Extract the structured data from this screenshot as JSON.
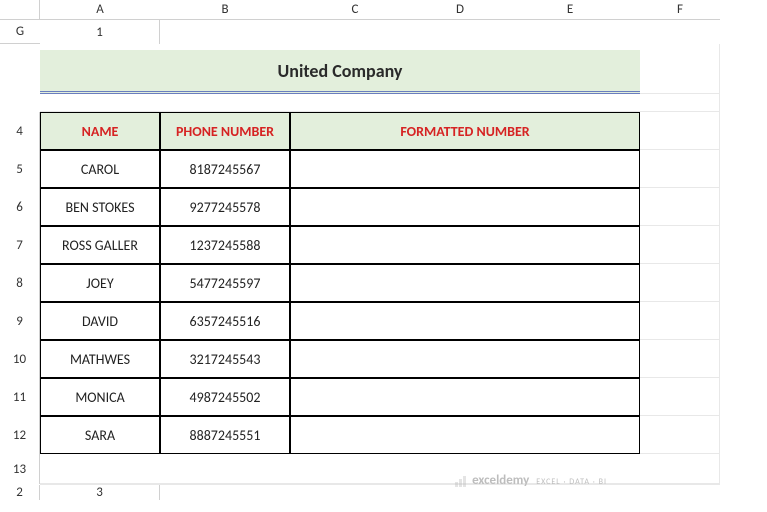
{
  "columns": [
    "A",
    "B",
    "C",
    "D",
    "E",
    "F",
    "G"
  ],
  "rows": [
    "1",
    "2",
    "3",
    "4",
    "5",
    "6",
    "7",
    "8",
    "9",
    "10",
    "11",
    "12",
    "13"
  ],
  "title": "United Company",
  "headers": {
    "name": "NAME",
    "phone": "PHONE NUMBER",
    "formatted": "FORMATTED NUMBER"
  },
  "data": [
    {
      "name": "CAROL",
      "phone": "8187245567",
      "formatted": ""
    },
    {
      "name": "BEN STOKES",
      "phone": "9277245578",
      "formatted": ""
    },
    {
      "name": "ROSS GALLER",
      "phone": "1237245588",
      "formatted": ""
    },
    {
      "name": "JOEY",
      "phone": "5477245597",
      "formatted": ""
    },
    {
      "name": "DAVID",
      "phone": "6357245516",
      "formatted": ""
    },
    {
      "name": "MATHWES",
      "phone": "3217245543",
      "formatted": ""
    },
    {
      "name": "MONICA",
      "phone": "4987245502",
      "formatted": ""
    },
    {
      "name": "SARA",
      "phone": "8887245551",
      "formatted": ""
    }
  ],
  "watermark": {
    "brand": "exceldemy",
    "tagline": "EXCEL · DATA · BI"
  }
}
